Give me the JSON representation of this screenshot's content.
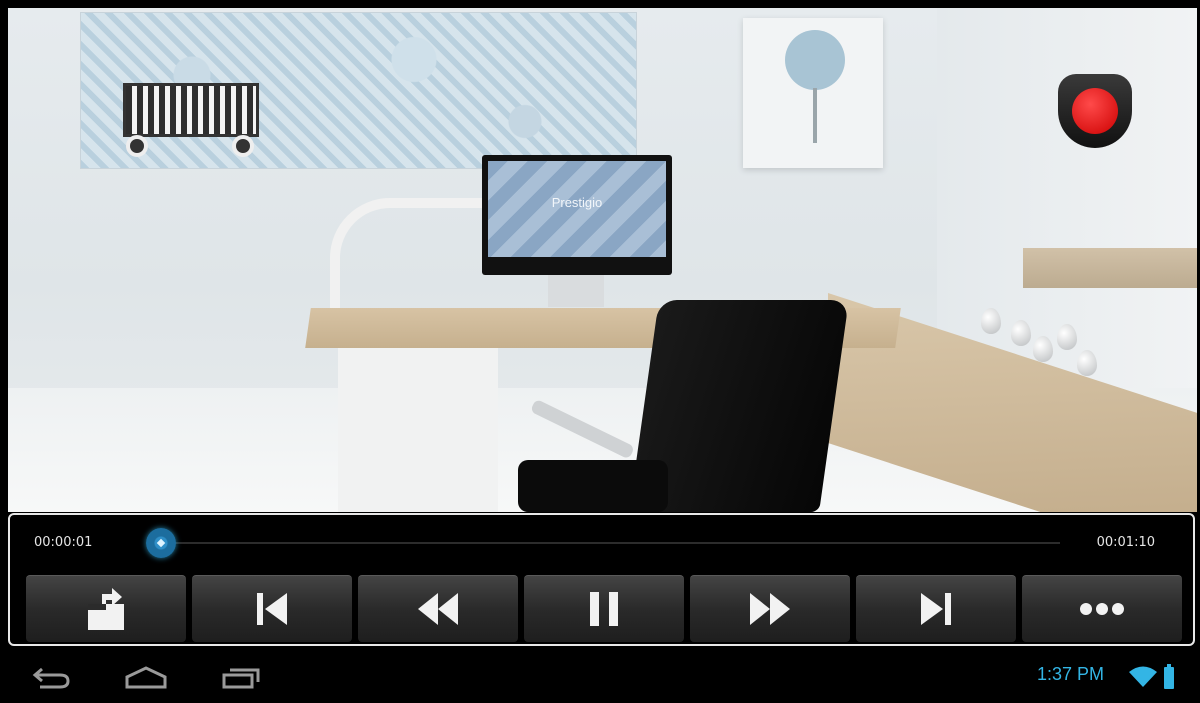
{
  "video": {
    "monitor_brand": "Prestigio",
    "logo": "prestigio-logo-badge"
  },
  "player": {
    "current_time": "00:00:01",
    "total_time": "00:01:10",
    "progress_fraction": 0.014,
    "buttons": [
      {
        "name": "share-button",
        "icon": "share-icon"
      },
      {
        "name": "previous-button",
        "icon": "skip-previous-icon"
      },
      {
        "name": "rewind-button",
        "icon": "rewind-icon"
      },
      {
        "name": "pause-button",
        "icon": "pause-icon"
      },
      {
        "name": "fast-forward-button",
        "icon": "fast-forward-icon"
      },
      {
        "name": "next-button",
        "icon": "skip-next-icon"
      },
      {
        "name": "more-button",
        "icon": "more-icon"
      }
    ],
    "accent_color": "#33b5e5"
  },
  "system_bar": {
    "time": "1:37 PM",
    "icons": [
      "back-icon",
      "home-icon",
      "recent-apps-icon",
      "wifi-icon",
      "battery-icon"
    ]
  }
}
